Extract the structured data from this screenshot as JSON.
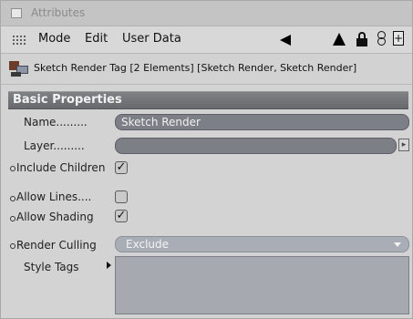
{
  "window": {
    "title": "Attributes"
  },
  "menubar": {
    "items": [
      "Mode",
      "Edit",
      "User Data"
    ]
  },
  "object": {
    "title": "Sketch Render Tag [2 Elements] [Sketch Render, Sketch Render]"
  },
  "section": {
    "title": "Basic Properties"
  },
  "properties": {
    "name_label": "Name.........",
    "name_value": "Sketch Render",
    "layer_label": "Layer.........",
    "layer_value": "",
    "include_children_label": "Include Children",
    "include_children_checked": true,
    "allow_lines_label": "Allow Lines....",
    "allow_lines_checked": false,
    "allow_shading_label": "Allow Shading",
    "allow_shading_checked": true,
    "render_culling_label": "Render Culling",
    "render_culling_value": "Exclude",
    "style_tags_label": "Style Tags"
  },
  "icons": {
    "title_icon": "window-icon",
    "grip": "grip-icon",
    "back": "back-arrow-icon",
    "up": "up-arrow-icon",
    "lock": "lock-icon",
    "ring": "link-icon",
    "new_window": "new-window-icon",
    "tag": "sketch-render-tag-icon",
    "layer_arrow": "chevron-right-icon",
    "dropdown_arrow": "chevron-down-icon",
    "style_arrow": "triangle-right-icon",
    "check_mark": "✓"
  },
  "colors": {
    "section_heading": "#6f7174",
    "field_dark": "#7c7f86",
    "field_light": "#a9adb5"
  }
}
